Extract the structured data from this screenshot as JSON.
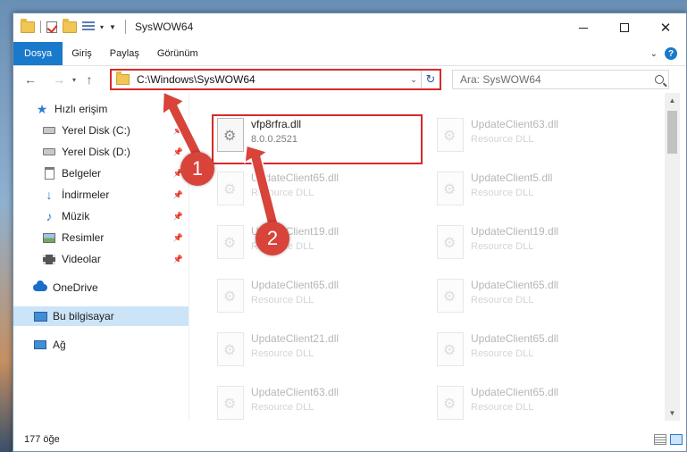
{
  "window": {
    "title": "SysWOW64"
  },
  "ribbon": {
    "tabs": [
      "Dosya",
      "Giriş",
      "Paylaş",
      "Görünüm"
    ]
  },
  "address": {
    "path": "C:\\Windows\\SysWOW64"
  },
  "search": {
    "placeholder": "Ara: SysWOW64"
  },
  "sidebar": {
    "items": [
      {
        "label": "Hızlı erişim",
        "icon": "star-icon"
      },
      {
        "label": "Yerel Disk (C:)",
        "icon": "drive-icon"
      },
      {
        "label": "Yerel Disk (D:)",
        "icon": "drive-icon"
      },
      {
        "label": "Belgeler",
        "icon": "documents-icon"
      },
      {
        "label": "İndirmeler",
        "icon": "downloads-icon"
      },
      {
        "label": "Müzik",
        "icon": "music-icon"
      },
      {
        "label": "Resimler",
        "icon": "pictures-icon"
      },
      {
        "label": "Videolar",
        "icon": "videos-icon"
      },
      {
        "label": "OneDrive",
        "icon": "cloud-icon"
      },
      {
        "label": "Bu bilgisayar",
        "icon": "computer-icon"
      },
      {
        "label": "Ağ",
        "icon": "network-icon"
      }
    ]
  },
  "files": [
    {
      "name": "vfp8rfra.dll",
      "sub": "8.0.0.2521"
    },
    {
      "name": "UpdateClient63.dll",
      "sub": "Resource DLL"
    },
    {
      "name": "UpdateClient65.dll",
      "sub": "Resource DLL"
    },
    {
      "name": "UpdateClient5.dll",
      "sub": "Resource DLL"
    },
    {
      "name": "UpdateClient19.dll",
      "sub": "Resource DLL"
    },
    {
      "name": "UpdateClient19.dll",
      "sub": "Resource DLL"
    },
    {
      "name": "UpdateClient65.dll",
      "sub": "Resource DLL"
    },
    {
      "name": "UpdateClient65.dll",
      "sub": "Resource DLL"
    },
    {
      "name": "UpdateClient21.dll",
      "sub": "Resource DLL"
    },
    {
      "name": "UpdateClient65.dll",
      "sub": "Resource DLL"
    },
    {
      "name": "UpdateClient63.dll",
      "sub": "Resource DLL"
    },
    {
      "name": "UpdateClient65.dll",
      "sub": "Resource DLL"
    }
  ],
  "status": {
    "count": "177 öğe"
  },
  "annotations": [
    "1",
    "2"
  ],
  "colors": {
    "accent": "#1979ca",
    "highlight": "#d62a2a",
    "arrow": "#d8433a"
  }
}
